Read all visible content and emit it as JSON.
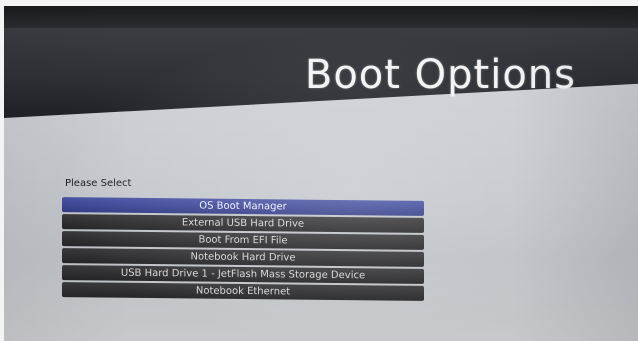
{
  "header": {
    "title": "Boot Options"
  },
  "menu": {
    "prompt": "Please Select",
    "selected_index": 0,
    "items": [
      {
        "label": "OS Boot Manager"
      },
      {
        "label": "External USB Hard Drive"
      },
      {
        "label": "Boot From EFI File"
      },
      {
        "label": "Notebook Hard Drive"
      },
      {
        "label": "USB Hard Drive 1 - JetFlash Mass Storage Device"
      },
      {
        "label": "Notebook Ethernet"
      }
    ]
  },
  "colors": {
    "header_bar": "#2e3136",
    "screen_background": "#c9ccd1",
    "selected_item": "#3b45a0",
    "menu_item": "#2e2e30",
    "title_text": "#f3f3f3"
  }
}
